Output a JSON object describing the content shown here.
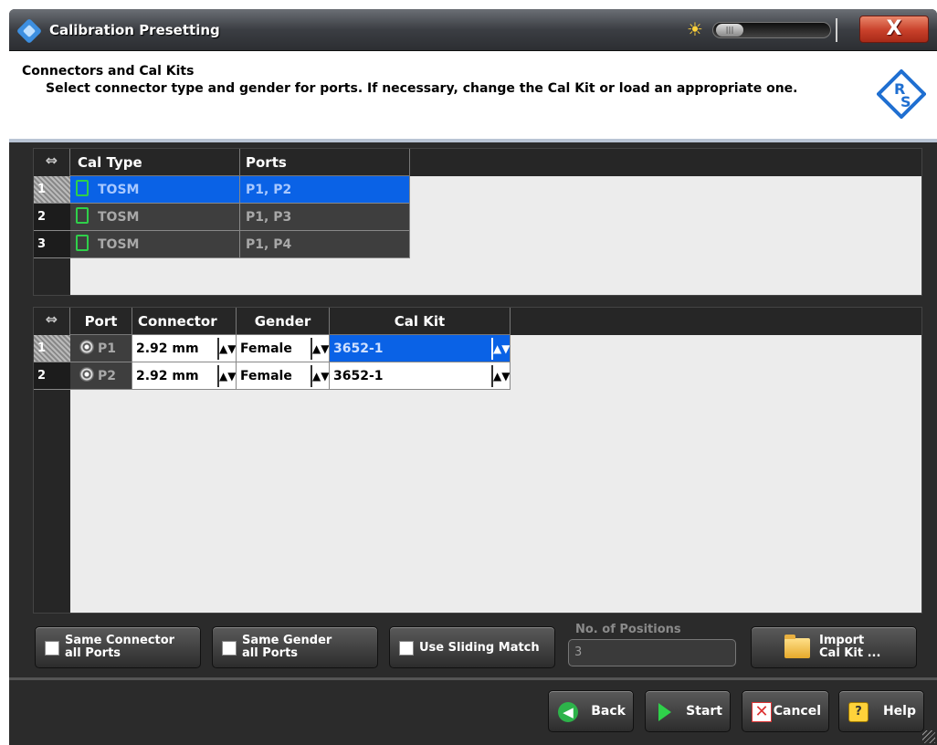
{
  "window": {
    "title": "Calibration Presetting",
    "close_label": "X"
  },
  "header": {
    "title": "Connectors and Cal Kits",
    "description": "Select connector type and gender for ports. If necessary, change the Cal Kit or load an appropriate one."
  },
  "cal_table": {
    "columns": [
      "Cal Type",
      "Ports"
    ],
    "rows": [
      {
        "num": "1",
        "cal_type": "TOSM",
        "ports": "P1, P2"
      },
      {
        "num": "2",
        "cal_type": "TOSM",
        "ports": "P1, P3"
      },
      {
        "num": "3",
        "cal_type": "TOSM",
        "ports": "P1, P4"
      }
    ]
  },
  "port_table": {
    "columns": [
      "Port",
      "Connector",
      "Gender",
      "Cal Kit"
    ],
    "rows": [
      {
        "num": "1",
        "port": "P1",
        "connector": "2.92 mm",
        "gender": "Female",
        "cal_kit": "3652-1"
      },
      {
        "num": "2",
        "port": "P2",
        "connector": "2.92 mm",
        "gender": "Female",
        "cal_kit": "3652-1"
      }
    ]
  },
  "controls": {
    "same_connector_line1": "Same Connector",
    "same_connector_line2": "all Ports",
    "same_gender_line1": "Same Gender",
    "same_gender_line2": "all Ports",
    "use_sliding_match": "Use Sliding Match",
    "positions_label": "No. of Positions",
    "positions_value": "3",
    "import_line1": "Import",
    "import_line2": "Cal Kit ..."
  },
  "nav": {
    "back": "Back",
    "start": "Start",
    "cancel": "Cancel",
    "help": "Help"
  },
  "colors": {
    "selection": "#0a62e6",
    "caltype_icon": "#2fd04a",
    "close_button": "#c8402a"
  }
}
